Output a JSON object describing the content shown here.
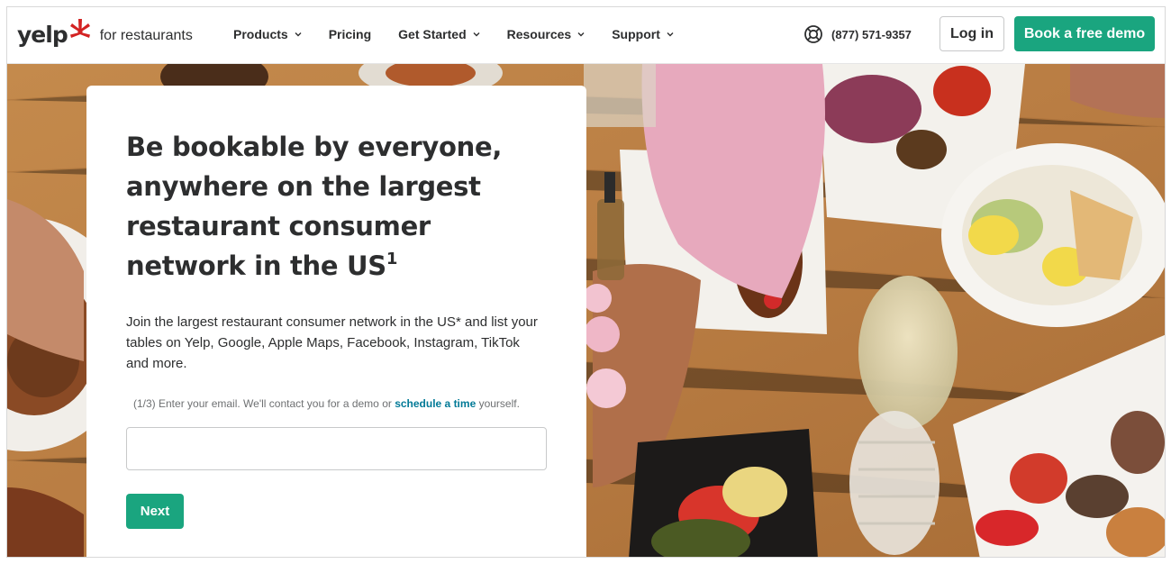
{
  "brand": {
    "wordmark": "yelp",
    "subtitle": "for restaurants",
    "color": "#d32323"
  },
  "nav": {
    "items": [
      {
        "label": "Products",
        "has_dropdown": true
      },
      {
        "label": "Pricing",
        "has_dropdown": false
      },
      {
        "label": "Get Started",
        "has_dropdown": true
      },
      {
        "label": "Resources",
        "has_dropdown": true
      },
      {
        "label": "Support",
        "has_dropdown": true
      }
    ]
  },
  "header": {
    "phone": "(877) 571-9357",
    "phone_icon": "lifebuoy-icon",
    "login_label": "Log in",
    "demo_label": "Book a free demo",
    "accent_color": "#1aa57f"
  },
  "hero": {
    "headline": "Be bookable by everyone, anywhere on the largest restaurant consumer network in the US",
    "footnote_mark": "1",
    "intro": "Join the largest restaurant consumer network in the US* and list your tables on Yelp, Google, Apple Maps, Facebook, Instagram, TikTok and more.",
    "step_prefix": "(1/3) Enter your email. We'll contact you for a demo or ",
    "step_link": "schedule a time",
    "step_suffix": " yourself.",
    "email_value": "",
    "next_label": "Next",
    "link_color": "#027a97"
  }
}
